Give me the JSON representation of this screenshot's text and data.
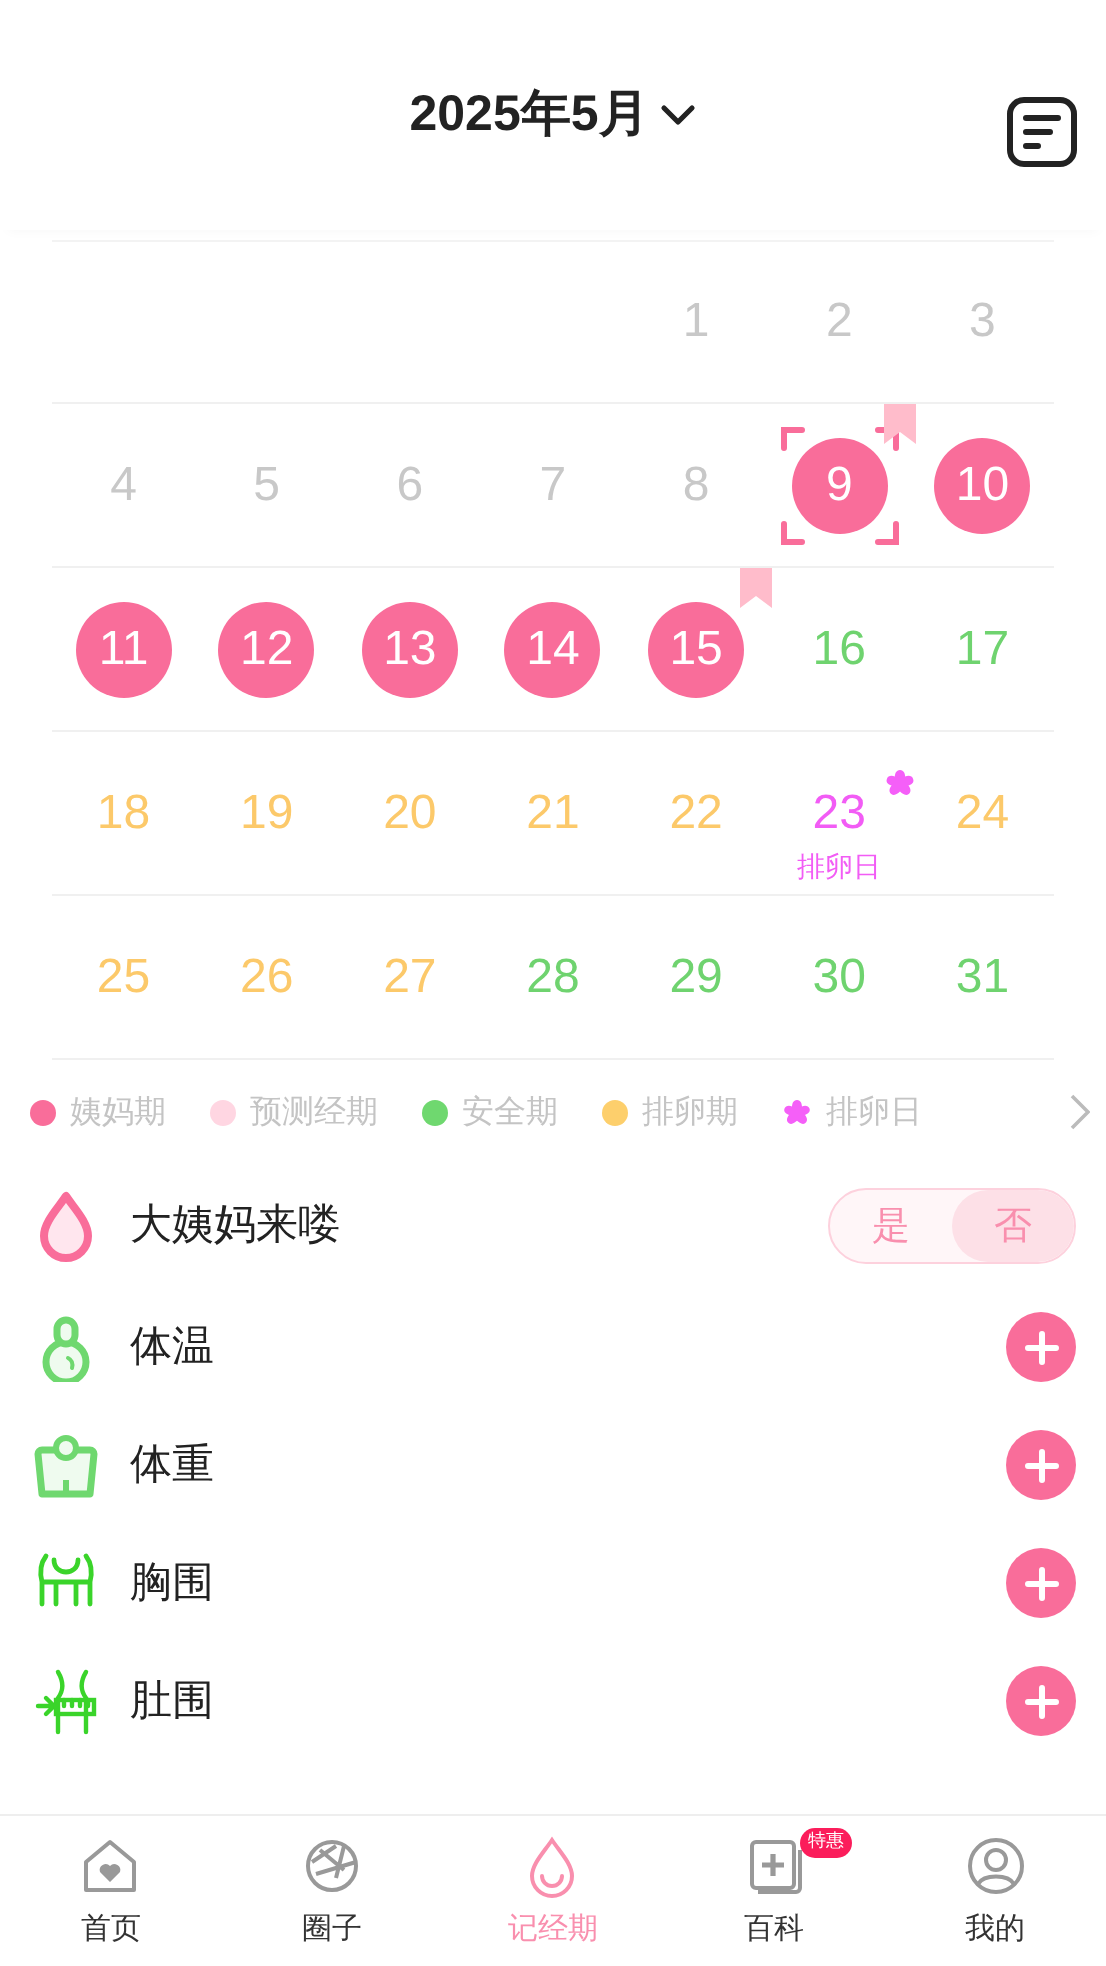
{
  "header": {
    "title": "2025年5月"
  },
  "calendar": {
    "weeks": [
      [
        {
          "day": "1",
          "kind": "past"
        },
        {
          "day": "2",
          "kind": "past"
        },
        {
          "day": "3",
          "kind": "past"
        }
      ],
      [
        {
          "day": "4",
          "kind": "past"
        },
        {
          "day": "5",
          "kind": "past"
        },
        {
          "day": "6",
          "kind": "past"
        },
        {
          "day": "7",
          "kind": "past"
        },
        {
          "day": "8",
          "kind": "past"
        },
        {
          "day": "9",
          "kind": "period",
          "today": true,
          "marked": true
        },
        {
          "day": "10",
          "kind": "period"
        }
      ],
      [
        {
          "day": "11",
          "kind": "period"
        },
        {
          "day": "12",
          "kind": "period"
        },
        {
          "day": "13",
          "kind": "period"
        },
        {
          "day": "14",
          "kind": "period"
        },
        {
          "day": "15",
          "kind": "period",
          "marked": true
        },
        {
          "day": "16",
          "kind": "safe"
        },
        {
          "day": "17",
          "kind": "safe"
        }
      ],
      [
        {
          "day": "18",
          "kind": "fertile"
        },
        {
          "day": "19",
          "kind": "fertile"
        },
        {
          "day": "20",
          "kind": "fertile"
        },
        {
          "day": "21",
          "kind": "fertile"
        },
        {
          "day": "22",
          "kind": "fertile"
        },
        {
          "day": "23",
          "kind": "ovulation",
          "note": "排卵日"
        },
        {
          "day": "24",
          "kind": "fertile"
        }
      ],
      [
        {
          "day": "25",
          "kind": "fertile"
        },
        {
          "day": "26",
          "kind": "fertile"
        },
        {
          "day": "27",
          "kind": "fertile"
        },
        {
          "day": "28",
          "kind": "safe"
        },
        {
          "day": "29",
          "kind": "safe"
        },
        {
          "day": "30",
          "kind": "safe"
        },
        {
          "day": "31",
          "kind": "safe"
        }
      ]
    ]
  },
  "legend": [
    {
      "label": "姨妈期",
      "kind": "dot",
      "color": "#f96d9a"
    },
    {
      "label": "预测经期",
      "kind": "dot",
      "color": "#ffd6e2"
    },
    {
      "label": "安全期",
      "kind": "dot",
      "color": "#6fd86f"
    },
    {
      "label": "排卵期",
      "kind": "dot",
      "color": "#fdcf6c"
    },
    {
      "label": "排卵日",
      "kind": "flower",
      "color": "#f55ff8"
    }
  ],
  "period_toggle": {
    "label": "大姨妈来喽",
    "options": [
      {
        "label": "是",
        "selected": false
      },
      {
        "label": "否",
        "selected": true
      }
    ]
  },
  "records": [
    {
      "label": "体温",
      "kind": "thermometer"
    },
    {
      "label": "体重",
      "kind": "scale"
    },
    {
      "label": "胸围",
      "kind": "chest"
    },
    {
      "label": "肚围",
      "kind": "waist"
    }
  ],
  "nav": [
    {
      "label": "首页",
      "kind": "home",
      "selected": false
    },
    {
      "label": "圈子",
      "kind": "circle",
      "selected": false
    },
    {
      "label": "记经期",
      "kind": "drop",
      "selected": true
    },
    {
      "label": "百科",
      "kind": "book",
      "selected": false,
      "badge": "特惠"
    },
    {
      "label": "我的",
      "kind": "user",
      "selected": false
    }
  ]
}
